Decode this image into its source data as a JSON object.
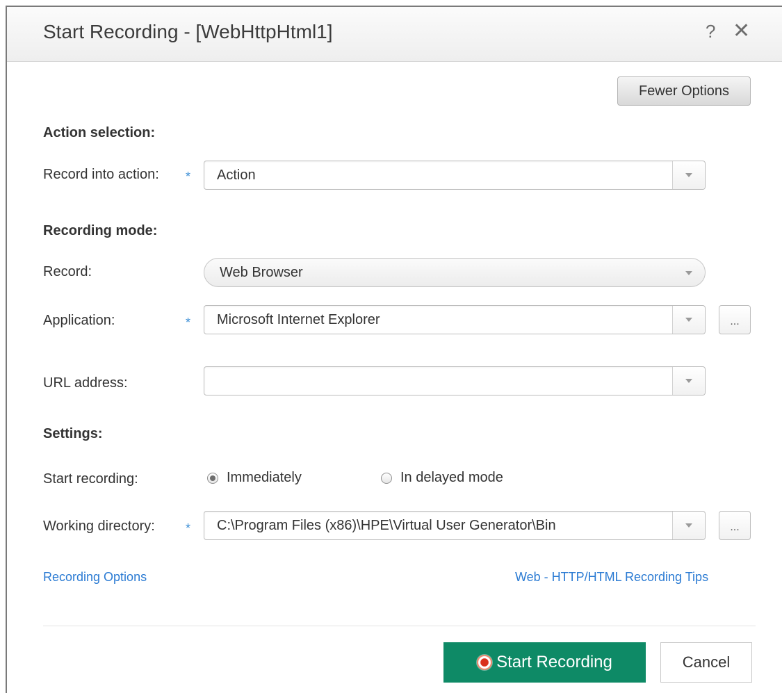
{
  "dialog": {
    "title": "Start Recording - [WebHttpHtml1]",
    "help_glyph": "?",
    "close_glyph": "✕"
  },
  "options_button": {
    "label": "Fewer Options"
  },
  "action_selection": {
    "heading": "Action selection:",
    "record_into_label": "Record into action:",
    "record_into_value": "Action"
  },
  "recording_mode": {
    "heading": "Recording mode:",
    "record_label": "Record:",
    "record_value": "Web Browser",
    "application_label": "Application:",
    "application_value": "Microsoft Internet Explorer",
    "url_label": "URL address:",
    "url_value": ""
  },
  "settings": {
    "heading": "Settings:",
    "start_recording_label": "Start recording:",
    "radio_immediately": "Immediately",
    "radio_delayed": "In delayed mode",
    "selected": "Immediately",
    "working_dir_label": "Working directory:",
    "working_dir_value": "C:\\Program Files (x86)\\HPE\\Virtual User Generator\\Bin"
  },
  "links": {
    "recording_options": "Recording Options",
    "tips": "Web - HTTP/HTML Recording Tips"
  },
  "footer": {
    "start_label": "Start Recording",
    "cancel_label": "Cancel"
  },
  "required_marker": "*",
  "browse_glyph": "...",
  "colors": {
    "primary_button": "#0e8a66",
    "link": "#2b7bd3",
    "required_marker": "#3d8fd6"
  }
}
